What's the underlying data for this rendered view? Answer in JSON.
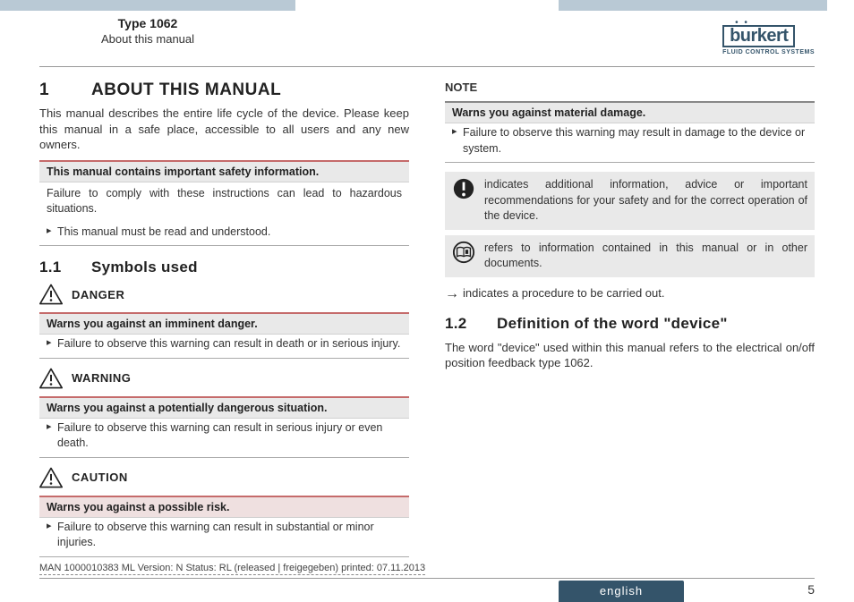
{
  "header": {
    "type_label": "Type 1062",
    "subtitle": "About this manual",
    "logo_text": "burkert",
    "logo_tagline": "FLUID CONTROL SYSTEMS"
  },
  "s1": {
    "num": "1",
    "title": "ABOUT THIS MANUAL",
    "intro": "This manual describes the entire life cycle of the device. Please keep this manual in a safe place, accessible to all users and any new owners."
  },
  "safety_box": {
    "heading": "This manual contains important safety information.",
    "body": "Failure to comply with these instructions can lead to hazardous situations.",
    "bullet": "This manual must be read and understood."
  },
  "s11": {
    "num": "1.1",
    "title": "Symbols used"
  },
  "danger": {
    "label": "DANGER",
    "heading": "Warns you against an imminent danger.",
    "bullet": "Failure to observe this warning can result in death or in serious injury."
  },
  "warning": {
    "label": "WARNING",
    "heading": "Warns you against a potentially dangerous situation.",
    "bullet": "Failure to observe this warning can result in serious injury or even death."
  },
  "caution": {
    "label": "CAUTION",
    "heading": "Warns you against a possible risk.",
    "bullet": "Failure to observe this warning can result in substantial or minor injuries."
  },
  "note": {
    "label": "NOTE",
    "heading": "Warns you against material damage.",
    "bullet": "Failure to observe this warning may result in damage to the device or system."
  },
  "info_row": "indicates additional information, advice or important recommendations for your safety and for the correct operation of the device.",
  "ref_row": "refers to information contained in this manual or in other documents.",
  "arrow_line": "indicates a procedure to be carried out.",
  "s12": {
    "num": "1.2",
    "title": "Definition of the word \"device\"",
    "body": "The word \"device\" used within this manual refers to the electrical on/off position feedback type 1062."
  },
  "footer": {
    "meta": "MAN 1000010383 ML Version: N Status: RL (released | freigegeben) printed: 07.11.2013",
    "language": "english",
    "page": "5"
  }
}
